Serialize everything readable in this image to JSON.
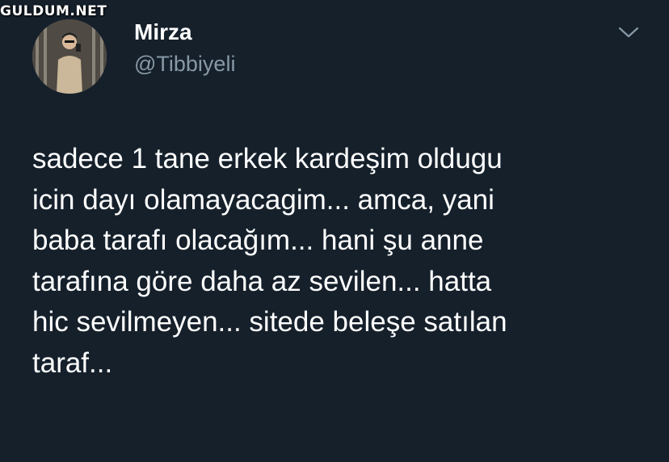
{
  "watermark": "GULDUM.NET",
  "tweet": {
    "display_name": "Mirza",
    "handle": "@Tibbiyeli",
    "text": "sadece 1 tane erkek kardeşim oldugu\nicin dayı olamayacagim... amca, yani\nbaba tarafı olacağım... hani şu anne\ntarafına göre daha az sevilen... hatta\nhic sevilmeyen... sitede beleşe satılan\ntaraf..."
  },
  "icons": {
    "avatar": "profile-photo",
    "menu": "chevron-down-icon"
  },
  "colors": {
    "background": "#15202b",
    "text_primary": "#ffffff",
    "text_secondary": "#8899a6"
  }
}
